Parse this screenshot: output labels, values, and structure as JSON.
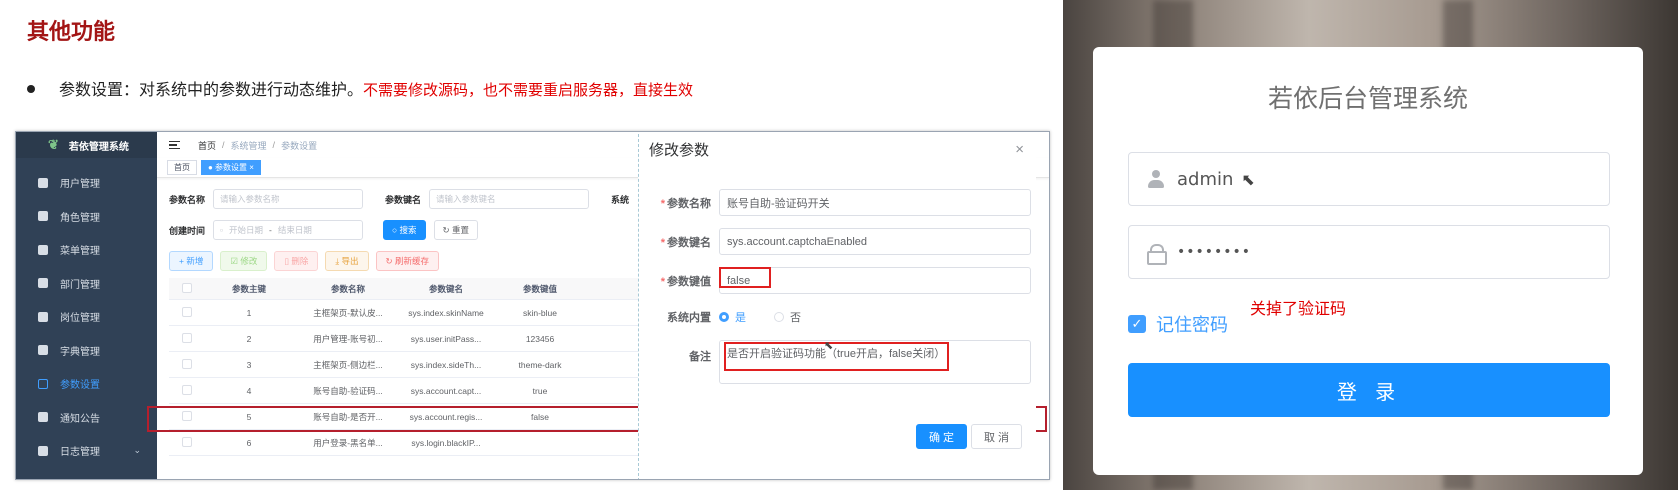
{
  "slide": {
    "title": "其他功能",
    "bullet_main": "参数设置：对系统中的参数进行动态维护。",
    "bullet_red": "不需要修改源码，也不需要重启服务器，直接生效"
  },
  "app": {
    "logo": "若依管理系统",
    "menu": [
      "用户管理",
      "角色管理",
      "菜单管理",
      "部门管理",
      "岗位管理",
      "字典管理",
      "参数设置",
      "通知公告",
      "日志管理"
    ],
    "active_menu": "参数设置",
    "breadcrumb": [
      "首页",
      "系统管理",
      "参数设置"
    ],
    "tags": [
      "首页",
      "● 参数设置 ×"
    ],
    "search": {
      "name_label": "参数名称",
      "name_placeholder": "请输入参数名称",
      "key_label": "参数键名",
      "key_placeholder": "请输入参数键名",
      "extra_label": "系统",
      "time_label": "创建时间",
      "start_placeholder": "开始日期",
      "range_sep": "-",
      "end_placeholder": "结束日期",
      "search_btn": "搜索",
      "reset_btn": "重置"
    },
    "toolbar": {
      "add": "+ 新增",
      "edit": "修改",
      "delete": "删除",
      "export": "导出",
      "refresh": "刷新缓存"
    },
    "table": {
      "headers": [
        "参数主键",
        "参数名称",
        "参数键名",
        "参数键值"
      ],
      "rows": [
        [
          "1",
          "主框架页-默认皮...",
          "sys.index.skinName",
          "skin-blue"
        ],
        [
          "2",
          "用户管理-账号初...",
          "sys.user.initPass...",
          "123456"
        ],
        [
          "3",
          "主框架页-侧边栏...",
          "sys.index.sideTh...",
          "theme-dark"
        ],
        [
          "4",
          "账号自助-验证码...",
          "sys.account.capt...",
          "true"
        ],
        [
          "5",
          "账号自助-是否开...",
          "sys.account.regis...",
          "false"
        ],
        [
          "6",
          "用户登录-黑名单...",
          "sys.login.blackIP...",
          ""
        ]
      ]
    },
    "dialog": {
      "title": "修改参数",
      "close": "×",
      "name_label": "参数名称",
      "name_value": "账号自助-验证码开关",
      "key_label": "参数键名",
      "key_value": "sys.account.captchaEnabled",
      "val_label": "参数键值",
      "val_value": "false",
      "builtin_label": "系统内置",
      "yes": "是",
      "no": "否",
      "remark_label": "备注",
      "remark_value": "是否开启验证码功能（true开启，false关闭）",
      "ok": "确 定",
      "cancel": "取 消"
    }
  },
  "login": {
    "title": "若依后台管理系统",
    "username": "admin",
    "password": "••••••••",
    "note": "关掉了验证码",
    "remember": "记住密码",
    "login_btn": "登 录",
    "accent": "#1890ff"
  }
}
